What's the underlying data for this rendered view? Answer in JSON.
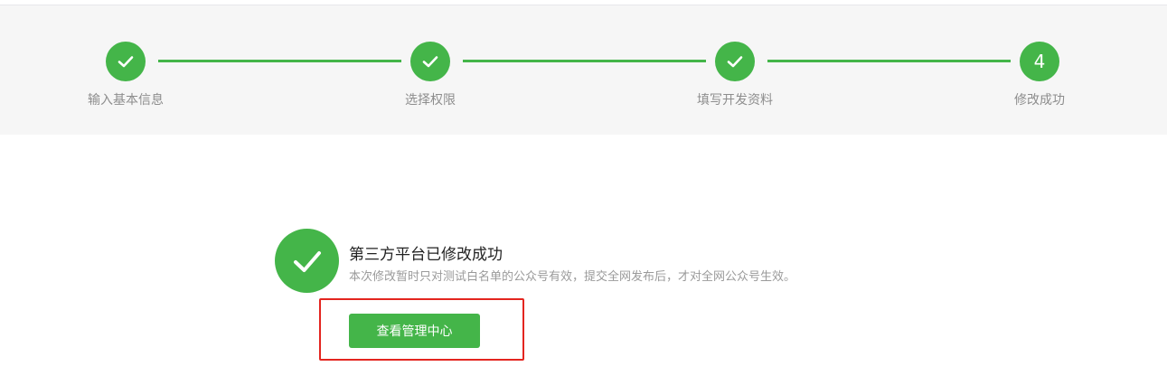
{
  "steps": [
    {
      "label": "输入基本信息",
      "state": "done",
      "icon": "check-icon"
    },
    {
      "label": "选择权限",
      "state": "done",
      "icon": "check-icon"
    },
    {
      "label": "填写开发资料",
      "state": "done",
      "icon": "check-icon"
    },
    {
      "label": "修改成功",
      "state": "current",
      "number": "4"
    }
  ],
  "result": {
    "icon": "check-icon",
    "title": "第三方平台已修改成功",
    "description": "本次修改暂时只对测试白名单的公众号有效，提交全网发布后，才对全网公众号生效。"
  },
  "actions": {
    "primary_label": "查看管理中心"
  },
  "colors": {
    "accent": "#44b549",
    "highlight": "#e3251f",
    "stepper_bg": "#f6f6f6"
  }
}
